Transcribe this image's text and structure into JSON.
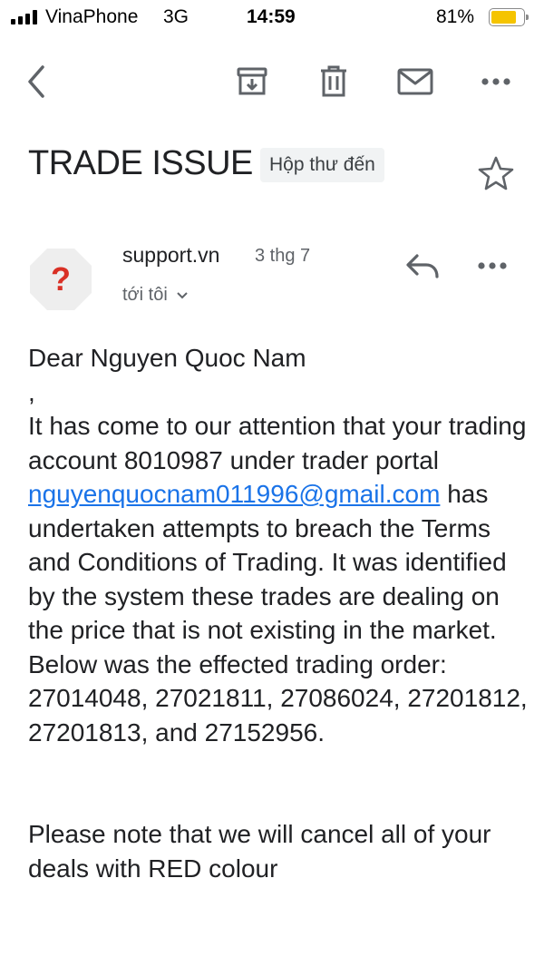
{
  "status_bar": {
    "carrier": "VinaPhone",
    "network": "3G",
    "time": "14:59",
    "battery_percent": "81%",
    "battery_level": 0.81,
    "battery_color": "#f5c400",
    "signal_bars": 4
  },
  "toolbar": {
    "back_icon": "chevron-left-icon",
    "archive_icon": "archive-icon",
    "delete_icon": "trash-icon",
    "mark_unread_icon": "mail-icon",
    "more_icon": "more-horizontal-icon"
  },
  "email": {
    "subject": "TRADE ISSUE",
    "label": "Hộp thư đến",
    "starred": false,
    "sender": {
      "name": "support.vn",
      "date": "3 thg 7",
      "to": "tới tôi",
      "avatar_symbol": "?",
      "avatar_color": "#d93025"
    },
    "body": {
      "greeting": "Dear Nguyen Quoc Nam",
      "comma": ",",
      "p1_before_link": "It has come to our attention that your trading account 8010987 under trader portal",
      "link": "nguyenquocnam011996@gmail.com",
      "p1_after_link": "has undertaken attempts to breach the Terms and Conditions of Trading. It was identified by the system these trades are dealing on the price that is not existing in the market. Below was the effected trading order: 27014048, 27021811, 27086024, 27201812, 27201813, and 27152956.",
      "p2": "Please note that we will cancel all of your deals with RED colour"
    }
  },
  "colors": {
    "accent_link": "#1a73e8",
    "icon_gray": "#5f6368"
  }
}
